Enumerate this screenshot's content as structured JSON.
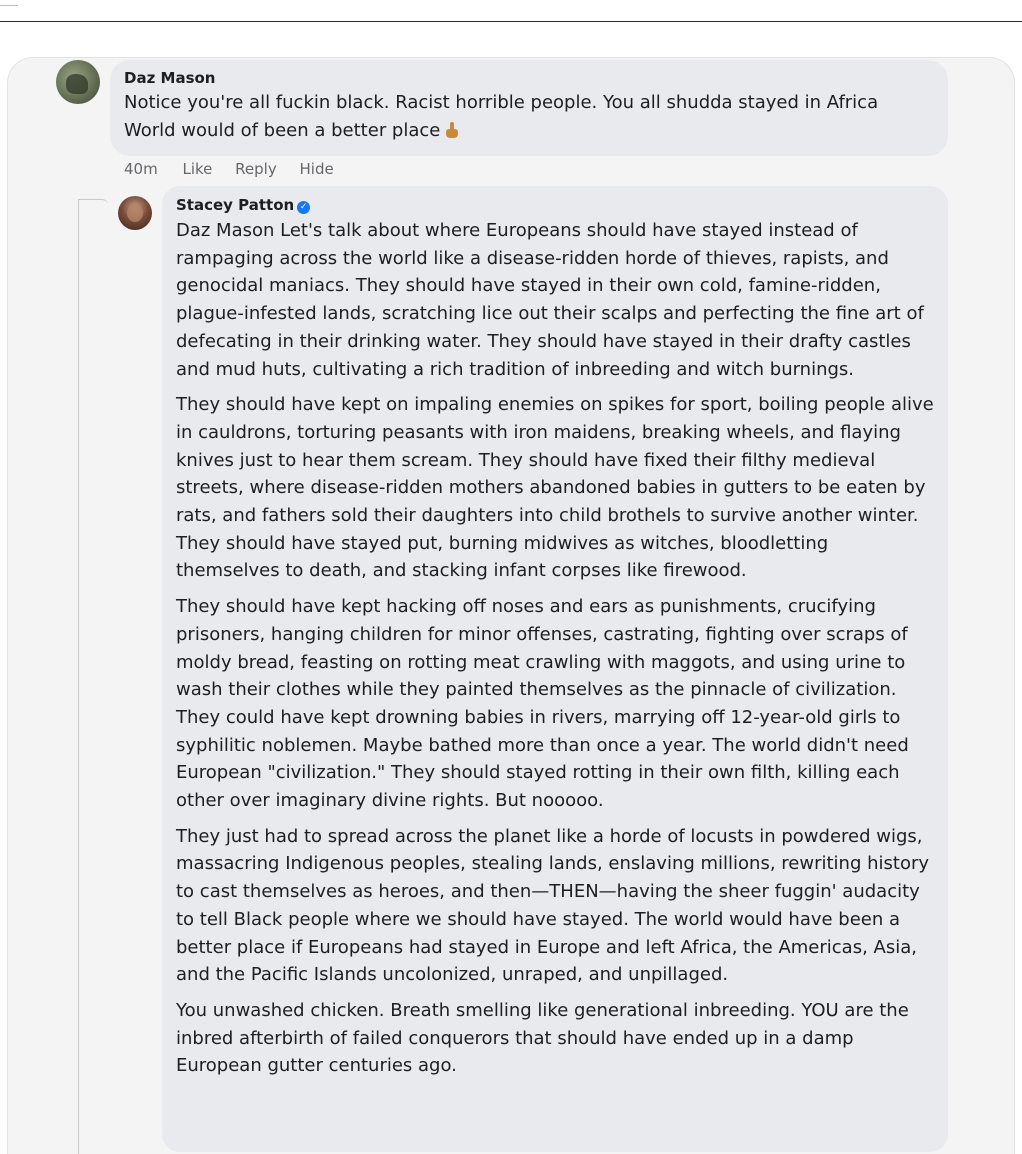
{
  "comment": {
    "author": "Daz Mason",
    "lines": [
      "Notice you're all fuckin black. Racist horrible people. You all shudda stayed in Africa",
      "World would of been a better place"
    ],
    "emoji_icon": "middle-finger-icon",
    "actions": {
      "time": "40m",
      "like": "Like",
      "reply": "Reply",
      "hide": "Hide"
    }
  },
  "reply": {
    "author": "Stacey Patton",
    "verified_icon": "verified-badge-icon",
    "paragraphs": [
      "Daz Mason Let's talk about where Europeans should have stayed instead of rampaging across the world like a disease-ridden horde of thieves, rapists, and genocidal maniacs. They should have stayed in their own cold, famine-ridden, plague-infested lands, scratching lice out their scalps and perfecting the fine art of defecating in their drinking water. They should have stayed in their drafty castles and mud huts, cultivating a rich tradition of inbreeding and witch burnings.",
      "They should have kept on impaling enemies on spikes for sport, boiling people alive in cauldrons, torturing peasants with iron maidens, breaking wheels, and flaying knives just to hear them scream. They should have fixed their filthy medieval streets, where disease-ridden mothers abandoned babies in gutters to be eaten by rats, and fathers sold their daughters into child brothels to survive another winter. They should have stayed put, burning midwives as witches, bloodletting themselves to death, and stacking infant corpses like firewood.",
      "They should have kept hacking off noses and ears as punishments, crucifying prisoners, hanging children for minor offenses, castrating, fighting over scraps of moldy bread, feasting on rotting meat crawling with maggots, and using urine to wash their clothes while they painted themselves as the pinnacle of civilization. They could have kept drowning babies in rivers, marrying off 12-year-old girls to syphilitic noblemen. Maybe bathed more than once a year. The world didn't need European \"civilization.\" They should stayed rotting in their own filth, killing each other over imaginary divine rights. But nooooo.",
      "They just had to spread across the planet like a horde of locusts in powdered wigs, massacring Indigenous peoples, stealing lands, enslaving millions, rewriting history to cast themselves as heroes, and then—THEN—having the sheer fuggin' audacity to tell Black people where we should have stayed. The world would have been a better place if Europeans had stayed in Europe and left Africa, the Americas, Asia, and the Pacific Islands uncolonized, unraped, and unpillaged.",
      "You unwashed chicken. Breath smelling like generational inbreeding. YOU are the inbred afterbirth of failed conquerors that should have ended up in a damp European gutter centuries ago."
    ]
  },
  "colors": {
    "bubble": "#e9eaee",
    "panel": "#f4f4f4",
    "meta_text": "#65676b",
    "verified": "#1877f2"
  }
}
